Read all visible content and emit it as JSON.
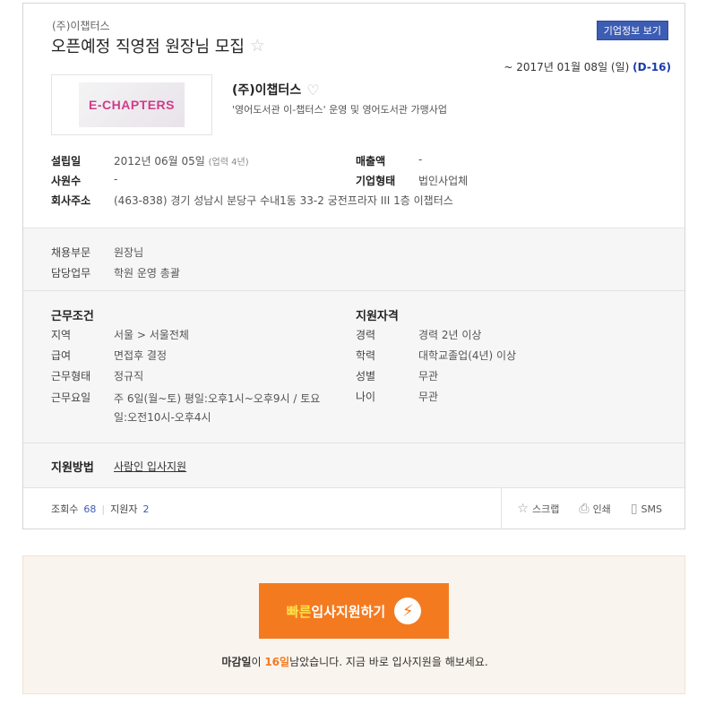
{
  "header": {
    "company_small": "(주)이챕터스",
    "title": "오픈예정 직영점 원장님 모집",
    "info_button": "기업정보 보기",
    "deadline_text": "~ 2017년 01월 08일 (일)",
    "dday": "(D-16)"
  },
  "company": {
    "logo_text": "E-CHAPTERS",
    "name": "(주)이챕터스",
    "description": "'영어도서관 이-챕터스' 운영 및 영어도서관 가맹사업"
  },
  "facts": {
    "founded_label": "설립일",
    "founded_value": "2012년 06월 05일",
    "founded_years": "(업력 4년)",
    "revenue_label": "매출액",
    "revenue_value": "-",
    "employees_label": "사원수",
    "employees_value": "-",
    "type_label": "기업형태",
    "type_value": "법인사업체",
    "address_label": "회사주소",
    "address_value": "(463-838) 경기 성남시 분당구 수내1동 33-2 궁전프라자 III 1층 이챕터스"
  },
  "job": {
    "dept_label": "채용부문",
    "dept_value": "원장님",
    "duty_label": "담당업무",
    "duty_value": "학원 운영 총괄"
  },
  "conditions": {
    "title": "근무조건",
    "region_label": "지역",
    "region_value": "서울 > 서울전체",
    "salary_label": "급여",
    "salary_value": "면접후 결정",
    "type_label": "근무형태",
    "type_value": "정규직",
    "days_label": "근무요일",
    "days_value_line1": "주 6일(월~토) 평일:오후1시~오후9시 / 토요",
    "days_value_line2": "일:오전10시-오후4시"
  },
  "qualifications": {
    "title": "지원자격",
    "career_label": "경력",
    "career_value": "경력 2년 이상",
    "education_label": "학력",
    "education_value": "대학교졸업(4년) 이상",
    "gender_label": "성별",
    "gender_value": "무관",
    "age_label": "나이",
    "age_value": "무관"
  },
  "apply": {
    "label": "지원방법",
    "method": "사람인 입사지원"
  },
  "stats": {
    "views_label": "조회수",
    "views": "68",
    "applicants_label": "지원자",
    "applicants": "2"
  },
  "actions": {
    "scrap": "스크랩",
    "print": "인쇄",
    "sms": "SMS"
  },
  "quick": {
    "button_hl": "빠른",
    "button_rest": "입사지원하기",
    "msg_prefix": "마감일",
    "msg_mid": "이 ",
    "msg_days": "16일",
    "msg_suffix": "남았습니다. 지금 바로 입사지원을 해보세요."
  },
  "colors": {
    "accent_blue": "#3d5db4",
    "orange": "#f47a20"
  }
}
